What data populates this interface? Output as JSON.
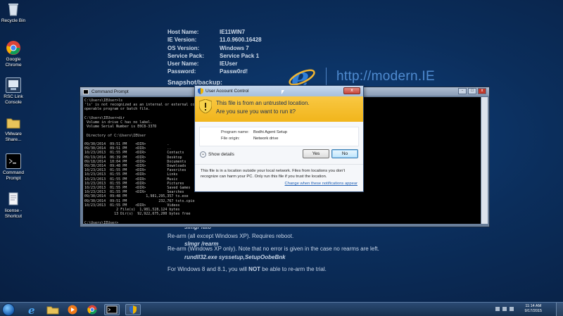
{
  "desktop_icons": [
    {
      "label": "Recycle Bin",
      "icon": "recycle-bin-icon"
    },
    {
      "label": "Google Chrome",
      "icon": "chrome-icon"
    },
    {
      "label": "RSC Link Console",
      "icon": "console-icon"
    },
    {
      "label": "VMware Share...",
      "icon": "folder-icon"
    },
    {
      "label": "Command Prompt",
      "icon": "command-prompt-icon"
    },
    {
      "label": "license - Shortcut",
      "icon": "document-shortcut-icon"
    }
  ],
  "info": {
    "rows": [
      {
        "key": "Host Name:",
        "value": "IE11WIN7"
      },
      {
        "key": "IE Version:",
        "value": "11.0.9600.16428"
      },
      {
        "key": "OS Version:",
        "value": "Windows 7"
      },
      {
        "key": "Service Pack:",
        "value": "Service Pack 1"
      },
      {
        "key": "User Name:",
        "value": "IEUser"
      },
      {
        "key": "Password:",
        "value": "Passw0rd!"
      }
    ],
    "snapshot": "Snapshot/backup:"
  },
  "brand": {
    "url": "http://modern.IE"
  },
  "bottom_text": {
    "cmd1": "slmgr /ato",
    "line1": "Re-arm (all except Windows XP). Requires reboot.",
    "cmd2": "slmgr /rearm",
    "line2": "Re-arm (Windows XP only). Note that no error is given in the case no rearms are left.",
    "cmd3": "rundll32.exe syssetup,SetupOobeBnk",
    "line3_pre": "For Windows 8 and 8.1, you will ",
    "line3_bold": "NOT",
    "line3_post": " be able to re-arm the trial."
  },
  "cmd_window": {
    "title": "Command Prompt",
    "content": "C:\\Users\\IEUser>ls\n'ls' is not recognized as an internal or external command,\noperable program or batch file.\n\nC:\\Users\\IEUser>dir\n Volume in drive C has no label.\n Volume Serial Number is E0C8-337D\n\n Directory of C:\\Users\\IEUser\n\n09/30/2014  09:51 PM    <DIR>          .\n09/30/2014  09:51 PM    <DIR>          ..\n10/23/2013  01:55 PM    <DIR>          Contacts\n09/19/2014  06:39 PM    <DIR>          Desktop\n09/18/2014  10:04 PM    <DIR>          Documents\n09/30/2014  09:48 PM    <DIR>          Downloads\n10/23/2013  01:55 PM    <DIR>          Favorites\n10/23/2013  01:55 PM    <DIR>          Links\n10/23/2013  01:55 PM    <DIR>          Music\n10/23/2013  01:55 PM    <DIR>          Pictures\n10/23/2013  01:55 PM    <DIR>          Saved Games\n10/23/2013  01:55 PM    <DIR>          Searches\n09/30/2014  09:48 PM         1,981,295,357 ts.exe\n09/30/2014  09:51 PM               232,767 tsts.cpio\n10/23/2013  01:55 PM    <DIR>          Videos\n               2 File(s)  1,981,528,124 bytes\n              13 Dir(s)  92,922,675,200 bytes free\n\nC:\\Users\\IEUser>",
    "controls": [
      "-",
      "□",
      "x"
    ]
  },
  "uac": {
    "title": "User Account Control",
    "close": "x",
    "banner_line1": "This file is from an untrusted location.",
    "banner_line2": "Are you sure you want to run it?",
    "details": [
      {
        "key": "Program name:",
        "value": "Bodhi Agent Setup"
      },
      {
        "key": "File origin:",
        "value": "Network drive"
      }
    ],
    "show_details": "Show details",
    "yes": "Yes",
    "no": "No",
    "footer": "This file is in a location outside your local network. Files from locations you don't recognize can harm your PC. Only run this file if you trust the location.",
    "link": "Change when these notifications appear"
  },
  "taskbar": {
    "time": "11:14 AM",
    "date": "9/17/2015"
  },
  "colors": {
    "uac_banner": "#f3bd2e",
    "desktop_bg": "#0b2e5c",
    "link": "#1f5fb4"
  }
}
